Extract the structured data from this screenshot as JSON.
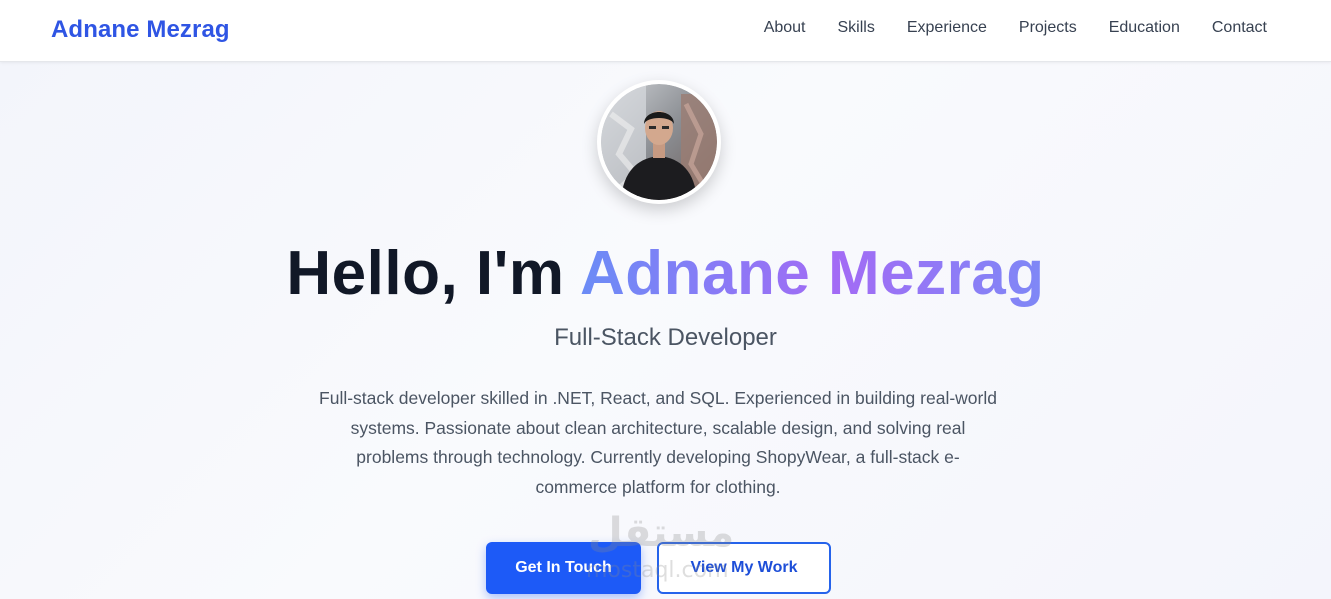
{
  "header": {
    "brand": "Adnane Mezrag",
    "nav": [
      {
        "label": "About"
      },
      {
        "label": "Skills"
      },
      {
        "label": "Experience"
      },
      {
        "label": "Projects"
      },
      {
        "label": "Education"
      },
      {
        "label": "Contact"
      }
    ]
  },
  "hero": {
    "greeting": "Hello, I'm",
    "name": "Adnane Mezrag",
    "subtitle": "Full-Stack Developer",
    "description": "Full-stack developer skilled in .NET, React, and SQL. Experienced in building real-world systems. Passionate about clean architecture, scalable design, and solving real problems through technology. Currently developing ShopyWear, a full-stack e-commerce platform for clothing.",
    "primary_button": "Get In Touch",
    "secondary_button": "View My Work"
  },
  "watermark": {
    "arabic": "مستقل",
    "latin": "mostaql.com"
  },
  "colors": {
    "brand": "#2f55e4",
    "primary_button": "#1d5af7",
    "name_gradient_start": "#6b8cf6",
    "name_gradient_mid": "#a36bf5"
  }
}
